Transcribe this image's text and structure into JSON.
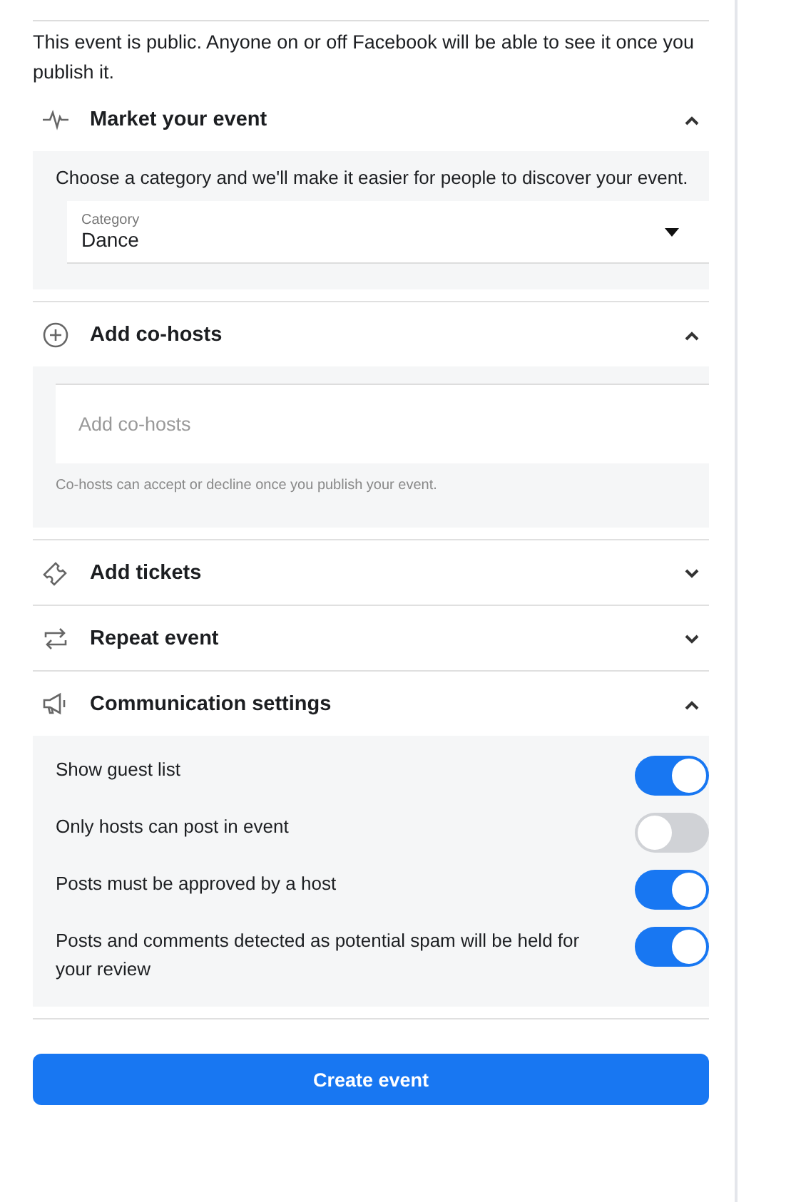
{
  "notice": "This event is public. Anyone on or off Facebook will be able to see it once you publish it.",
  "sections": [
    {
      "kind": "category",
      "title": "Market your event",
      "expanded": true,
      "description": "Choose a category and we'll make it easier for people to discover your event.",
      "field_label": "Category",
      "value": "Dance"
    },
    {
      "kind": "cohosts",
      "title": "Add co-hosts",
      "expanded": true,
      "placeholder": "Add co-hosts",
      "note": "Co-hosts can accept or decline once you publish your event."
    },
    {
      "title": "Add tickets",
      "expanded": false
    },
    {
      "title": "Repeat event",
      "expanded": false
    },
    {
      "kind": "toggles",
      "title": "Communication settings",
      "expanded": true,
      "settings": [
        {
          "label": "Show guest list",
          "on": true
        },
        {
          "label": "Only hosts can post in event",
          "on": false
        },
        {
          "label": "Posts must be approved by a host",
          "on": true
        },
        {
          "label": "Posts and comments detected as potential spam will be held for your review",
          "on": true
        }
      ]
    }
  ],
  "create_button": "Create event"
}
